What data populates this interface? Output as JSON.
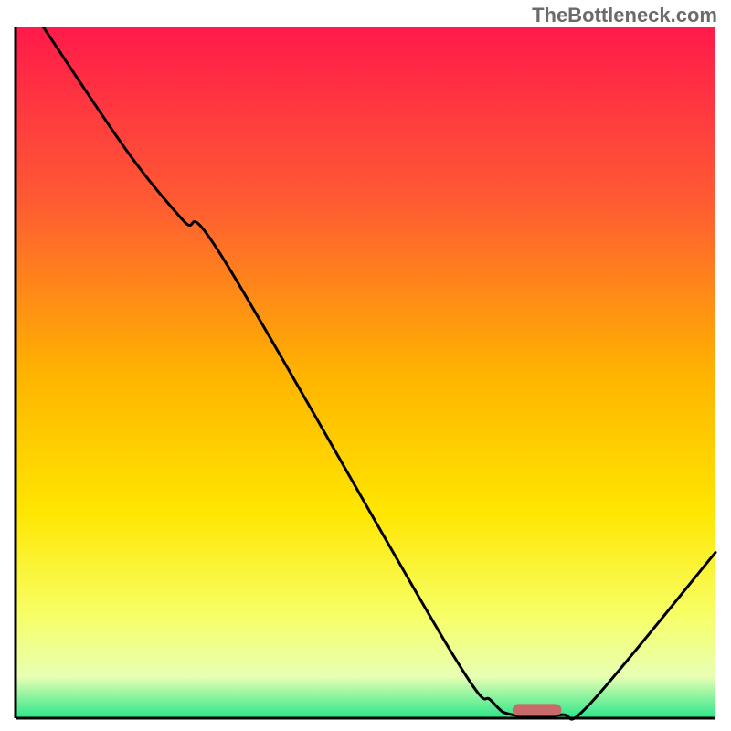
{
  "attribution": "TheBottleneck.com",
  "chart_data": {
    "type": "line",
    "title": "",
    "xlabel": "",
    "ylabel": "",
    "xlim": [
      0,
      100
    ],
    "ylim": [
      0,
      100
    ],
    "background_gradient": {
      "stops": [
        {
          "offset": 0,
          "color": "#ff1a4a"
        },
        {
          "offset": 25,
          "color": "#ff5a33"
        },
        {
          "offset": 50,
          "color": "#ffb300"
        },
        {
          "offset": 70,
          "color": "#ffe600"
        },
        {
          "offset": 85,
          "color": "#f7ff66"
        },
        {
          "offset": 94,
          "color": "#e8ffb3"
        },
        {
          "offset": 100,
          "color": "#29e68a"
        }
      ]
    },
    "curve_points": [
      {
        "x": 4,
        "y": 100
      },
      {
        "x": 16,
        "y": 82
      },
      {
        "x": 24,
        "y": 72
      },
      {
        "x": 30,
        "y": 66
      },
      {
        "x": 62,
        "y": 10
      },
      {
        "x": 68,
        "y": 2.5
      },
      {
        "x": 71,
        "y": 0.5
      },
      {
        "x": 78,
        "y": 0.5
      },
      {
        "x": 82,
        "y": 2
      },
      {
        "x": 100,
        "y": 24
      }
    ],
    "marker": {
      "x_center": 74.5,
      "y": 1.2,
      "width": 7,
      "color": "#c96a6a"
    },
    "axis_color": "#000000",
    "curve_color": "#000000"
  }
}
